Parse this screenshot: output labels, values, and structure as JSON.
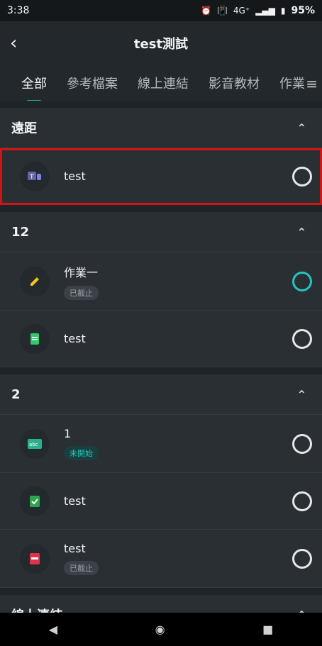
{
  "status": {
    "time": "3:38",
    "network": "4G⁺",
    "battery": "95%"
  },
  "header": {
    "title": "test測試"
  },
  "tabs": [
    "全部",
    "參考檔案",
    "線上連結",
    "影音教材",
    "作業"
  ],
  "sections": [
    {
      "title": "遠距",
      "items": [
        {
          "title": "test",
          "badge": ""
        }
      ]
    },
    {
      "title": "12",
      "items": [
        {
          "title": "作業一",
          "badge": "已截止"
        },
        {
          "title": "test",
          "badge": ""
        }
      ]
    },
    {
      "title": "2",
      "items": [
        {
          "title": "1",
          "badge": "未開始"
        },
        {
          "title": "test",
          "badge": ""
        },
        {
          "title": "test",
          "badge": "已截止"
        }
      ]
    },
    {
      "title": "線上連結",
      "items": []
    }
  ],
  "colors": {
    "accent": "#1bb8b3",
    "highlight": "#d11414",
    "background": "#1f2428",
    "card": "#2a2f33"
  },
  "icons": [
    "teams-icon",
    "pencil-icon",
    "document-icon",
    "abc-icon",
    "check-form-icon",
    "pdf-icon"
  ]
}
